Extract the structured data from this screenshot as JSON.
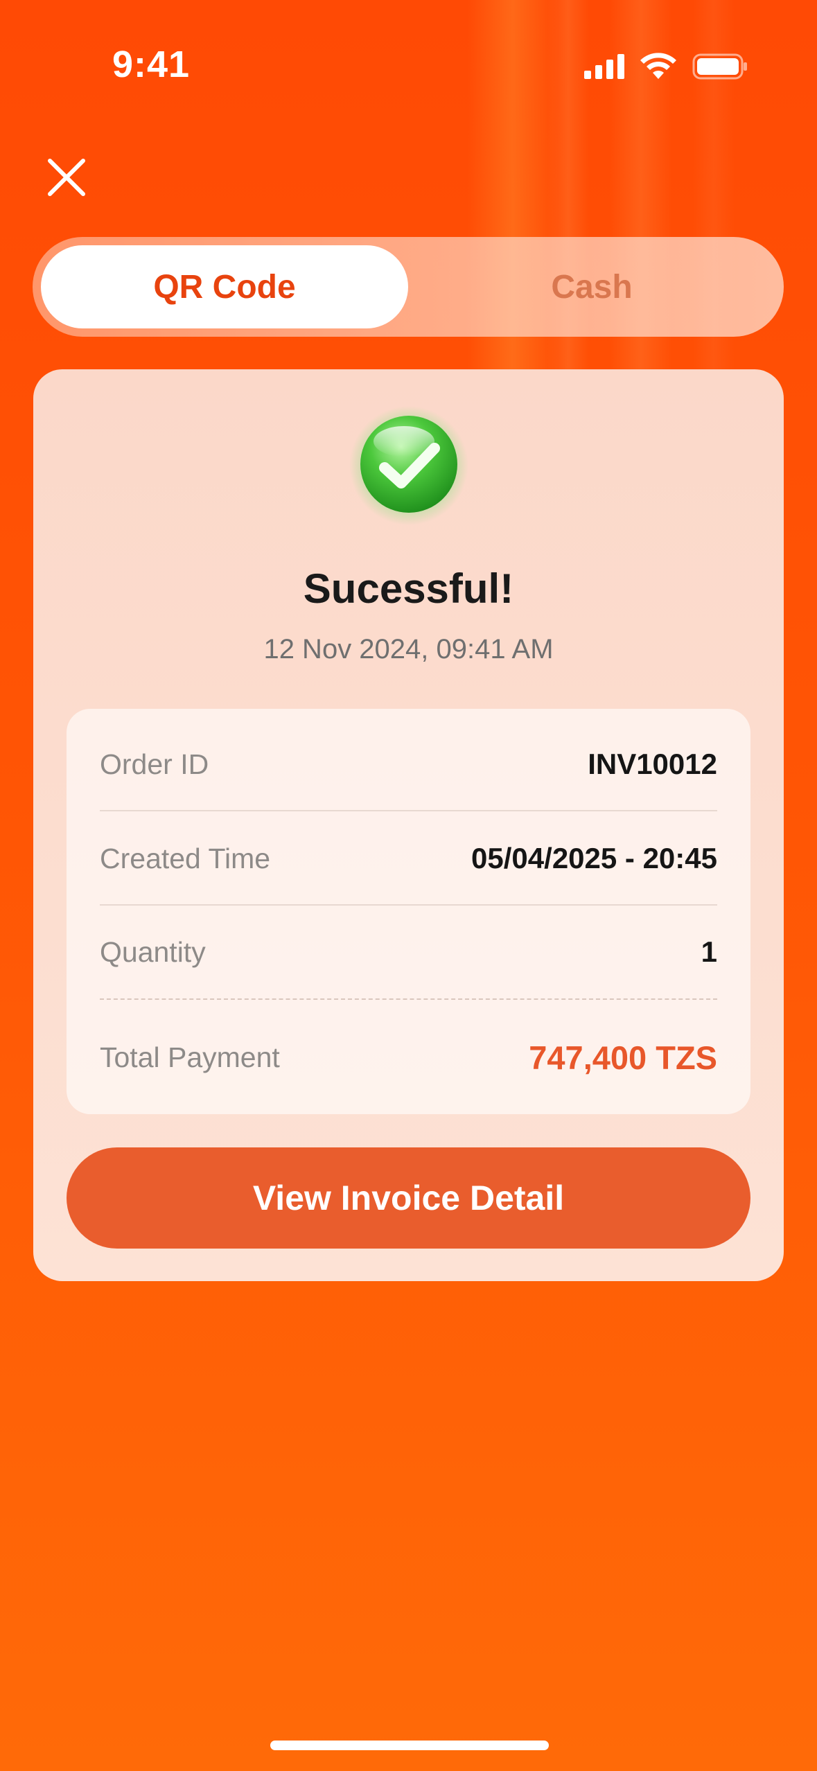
{
  "status_bar": {
    "time": "9:41",
    "icons": [
      "cellular-signal-icon",
      "wifi-icon",
      "battery-icon"
    ]
  },
  "header": {
    "close_icon": "close-icon"
  },
  "tabs": [
    {
      "label": "QR Code",
      "active": true
    },
    {
      "label": "Cash",
      "active": false
    }
  ],
  "result": {
    "icon": "success-check-icon",
    "title": "Sucessful!",
    "datetime": "12 Nov 2024, 09:41 AM"
  },
  "details": [
    {
      "label": "Order ID",
      "value": "INV10012"
    },
    {
      "label": "Created Time",
      "value": "05/04/2025 - 20:45"
    },
    {
      "label": "Quantity",
      "value": "1"
    },
    {
      "label": "Total Payment",
      "value": "747,400 TZS"
    }
  ],
  "actions": {
    "primary_label": "View Invoice Detail"
  },
  "colors": {
    "background": "#ff5505",
    "accent": "#e8430e",
    "button": "#e95d2d",
    "success": "#3db83a"
  }
}
